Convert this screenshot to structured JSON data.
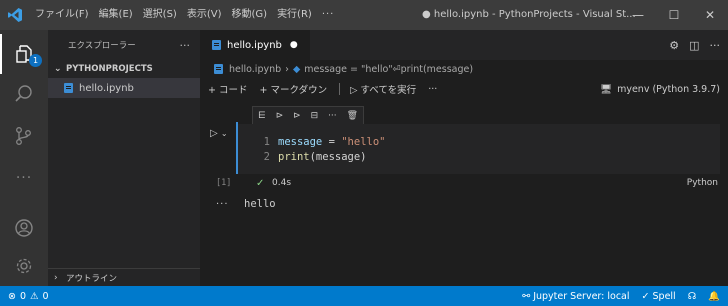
{
  "titlebar": {
    "menu": [
      "ファイル(F)",
      "編集(E)",
      "選択(S)",
      "表示(V)",
      "移動(G)",
      "実行(R)",
      "···"
    ],
    "window_title": "● hello.ipynb - PythonProjects - Visual St...",
    "minimize": "—",
    "maximize": "☐",
    "close": "✕"
  },
  "activitybar": {
    "explorer_badge": "1"
  },
  "sidebar": {
    "title": "エクスプローラー",
    "more": "···",
    "section": "PYTHONPROJECTS",
    "file": "hello.ipynb",
    "outline": "アウトライン"
  },
  "editor": {
    "tab_label": "hello.ipynb",
    "tab_dirty": "●",
    "breadcrumb": {
      "file": "hello.ipynb",
      "symbol": "message = \"hello\"⏎print(message)"
    },
    "toolbar": {
      "add_code": "+ コード",
      "add_markdown": "+ マークダウン",
      "run_all": "すべてを実行",
      "more": "···",
      "kernel": "myenv (Python 3.9.7)"
    },
    "cell": {
      "line1_no": "1",
      "line1_var": "message",
      "line1_op": " = ",
      "line1_str": "\"hello\"",
      "line2_no": "2",
      "line2_fn": "print",
      "line2_rest": "(message)",
      "exec_count": "[1]",
      "exec_time": "0.4s",
      "language": "Python",
      "output_more": "···",
      "output": "hello"
    }
  },
  "statusbar": {
    "errors": "0",
    "warnings": "0",
    "jupyter": "Jupyter Server: local",
    "spell": "✓ Spell"
  }
}
